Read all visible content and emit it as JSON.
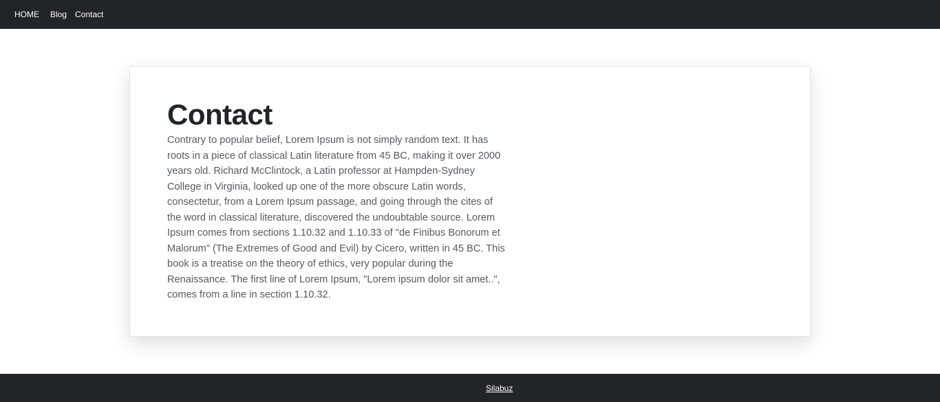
{
  "nav": {
    "home_label": "HOME",
    "blog_label": "Blog",
    "contact_label": "Contact"
  },
  "main": {
    "title": "Contact",
    "body": "Contrary to popular belief, Lorem Ipsum is not simply random text. It has roots in a piece of classical Latin literature from 45 BC, making it over 2000 years old. Richard McClintock, a Latin professor at Hampden-Sydney College in Virginia, looked up one of the more obscure Latin words, consectetur, from a Lorem Ipsum passage, and going through the cites of the word in classical literature, discovered the undoubtable source. Lorem Ipsum comes from sections 1.10.32 and 1.10.33 of \"de Finibus Bonorum et Malorum\" (The Extremes of Good and Evil) by Cicero, written in 45 BC. This book is a treatise on the theory of ethics, very popular during the Renaissance. The first line of Lorem Ipsum, \"Lorem ipsum dolor sit amet..\", comes from a line in section 1.10.32."
  },
  "footer": {
    "link_label": "Silabuz"
  },
  "colors": {
    "navbar_bg": "#212529",
    "footer_bg": "#212529",
    "text": "#212529",
    "body_text": "#555a60"
  }
}
